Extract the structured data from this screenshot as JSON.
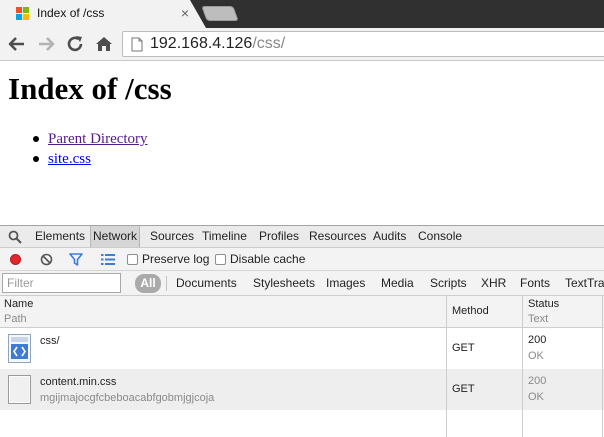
{
  "browser": {
    "tab_title": "Index of /css",
    "tab_close_glyph": "×",
    "url_host": "192.168.4.126",
    "url_path": "/css/",
    "favicon_colors": [
      "#f25022",
      "#7fba00",
      "#00a4ef",
      "#ffb900"
    ]
  },
  "page": {
    "heading": "Index of /css",
    "links": [
      {
        "label": "Parent Directory"
      },
      {
        "label": "site.css"
      }
    ]
  },
  "devtools": {
    "tabs": [
      "Elements",
      "Network",
      "Sources",
      "Timeline",
      "Profiles",
      "Resources",
      "Audits",
      "Console"
    ],
    "active_tab": "Network",
    "preserve_log_label": "Preserve log",
    "disable_cache_label": "Disable cache",
    "filter_placeholder": "Filter",
    "type_filters": [
      "All",
      "Documents",
      "Stylesheets",
      "Images",
      "Media",
      "Scripts",
      "XHR",
      "Fonts",
      "TextTra"
    ],
    "columns": {
      "name": "Name",
      "path": "Path",
      "method": "Method",
      "status": "Status",
      "text": "Text"
    },
    "requests": [
      {
        "name": "css/",
        "path": "",
        "method": "GET",
        "status": "200",
        "status_text": "OK",
        "icon": "html-document-icon"
      },
      {
        "name": "content.min.css",
        "path": "mgijmajocgfcbeboacabfgobmjgjcoja",
        "method": "GET",
        "status": "200",
        "status_text": "OK",
        "icon": "generic-file-icon"
      }
    ]
  }
}
